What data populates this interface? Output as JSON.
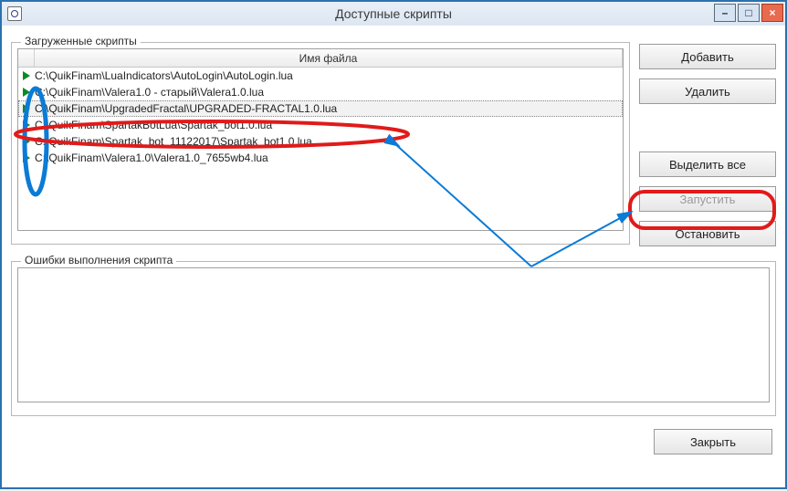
{
  "window": {
    "title": "Доступные скрипты"
  },
  "groups": {
    "loaded_label": "Загруженные скрипты",
    "errors_label": "Ошибки выполнения скрипта"
  },
  "columns": {
    "filename": "Имя файла"
  },
  "scripts": [
    {
      "path": "C:\\QuikFinam\\LuaIndicators\\AutoLogin\\AutoLogin.lua",
      "running": true,
      "selected": false
    },
    {
      "path": "C:\\QuikFinam\\Valera1.0 - старый\\Valera1.0.lua",
      "running": true,
      "selected": false
    },
    {
      "path": "C:\\QuikFinam\\UpgradedFractal\\UPGRADED-FRACTAL1.0.lua",
      "running": true,
      "selected": true
    },
    {
      "path": "C:\\QuikFinam\\SpartakBotLua\\Spartak_bot1.0.lua",
      "running": true,
      "selected": false
    },
    {
      "path": "C:\\QuikFinam\\Spartak_bot_11122017\\Spartak_bot1.0.lua",
      "running": true,
      "selected": false
    },
    {
      "path": "C:\\QuikFinam\\Valera1.0\\Valera1.0_7655wb4.lua",
      "running": true,
      "selected": false
    }
  ],
  "buttons": {
    "add": "Добавить",
    "remove": "Удалить",
    "select_all": "Выделить все",
    "run": "Запустить",
    "stop": "Остановить",
    "close": "Закрыть"
  },
  "winbtns": {
    "min": "–",
    "max": "□",
    "close": "×"
  }
}
